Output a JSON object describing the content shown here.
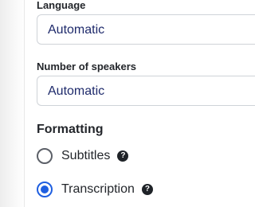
{
  "language": {
    "label": "Language",
    "value": "Automatic"
  },
  "speakers": {
    "label": "Number of speakers",
    "value": "Automatic"
  },
  "formatting": {
    "heading": "Formatting",
    "options": [
      {
        "label": "Subtitles",
        "selected": false,
        "help_icon": "question-circle-icon",
        "help_glyph": "?"
      },
      {
        "label": "Transcription",
        "selected": true,
        "help_icon": "question-circle-icon",
        "help_glyph": "?"
      }
    ]
  },
  "colors": {
    "accent": "#1f5fe0",
    "select_text": "#1e2a6b"
  }
}
